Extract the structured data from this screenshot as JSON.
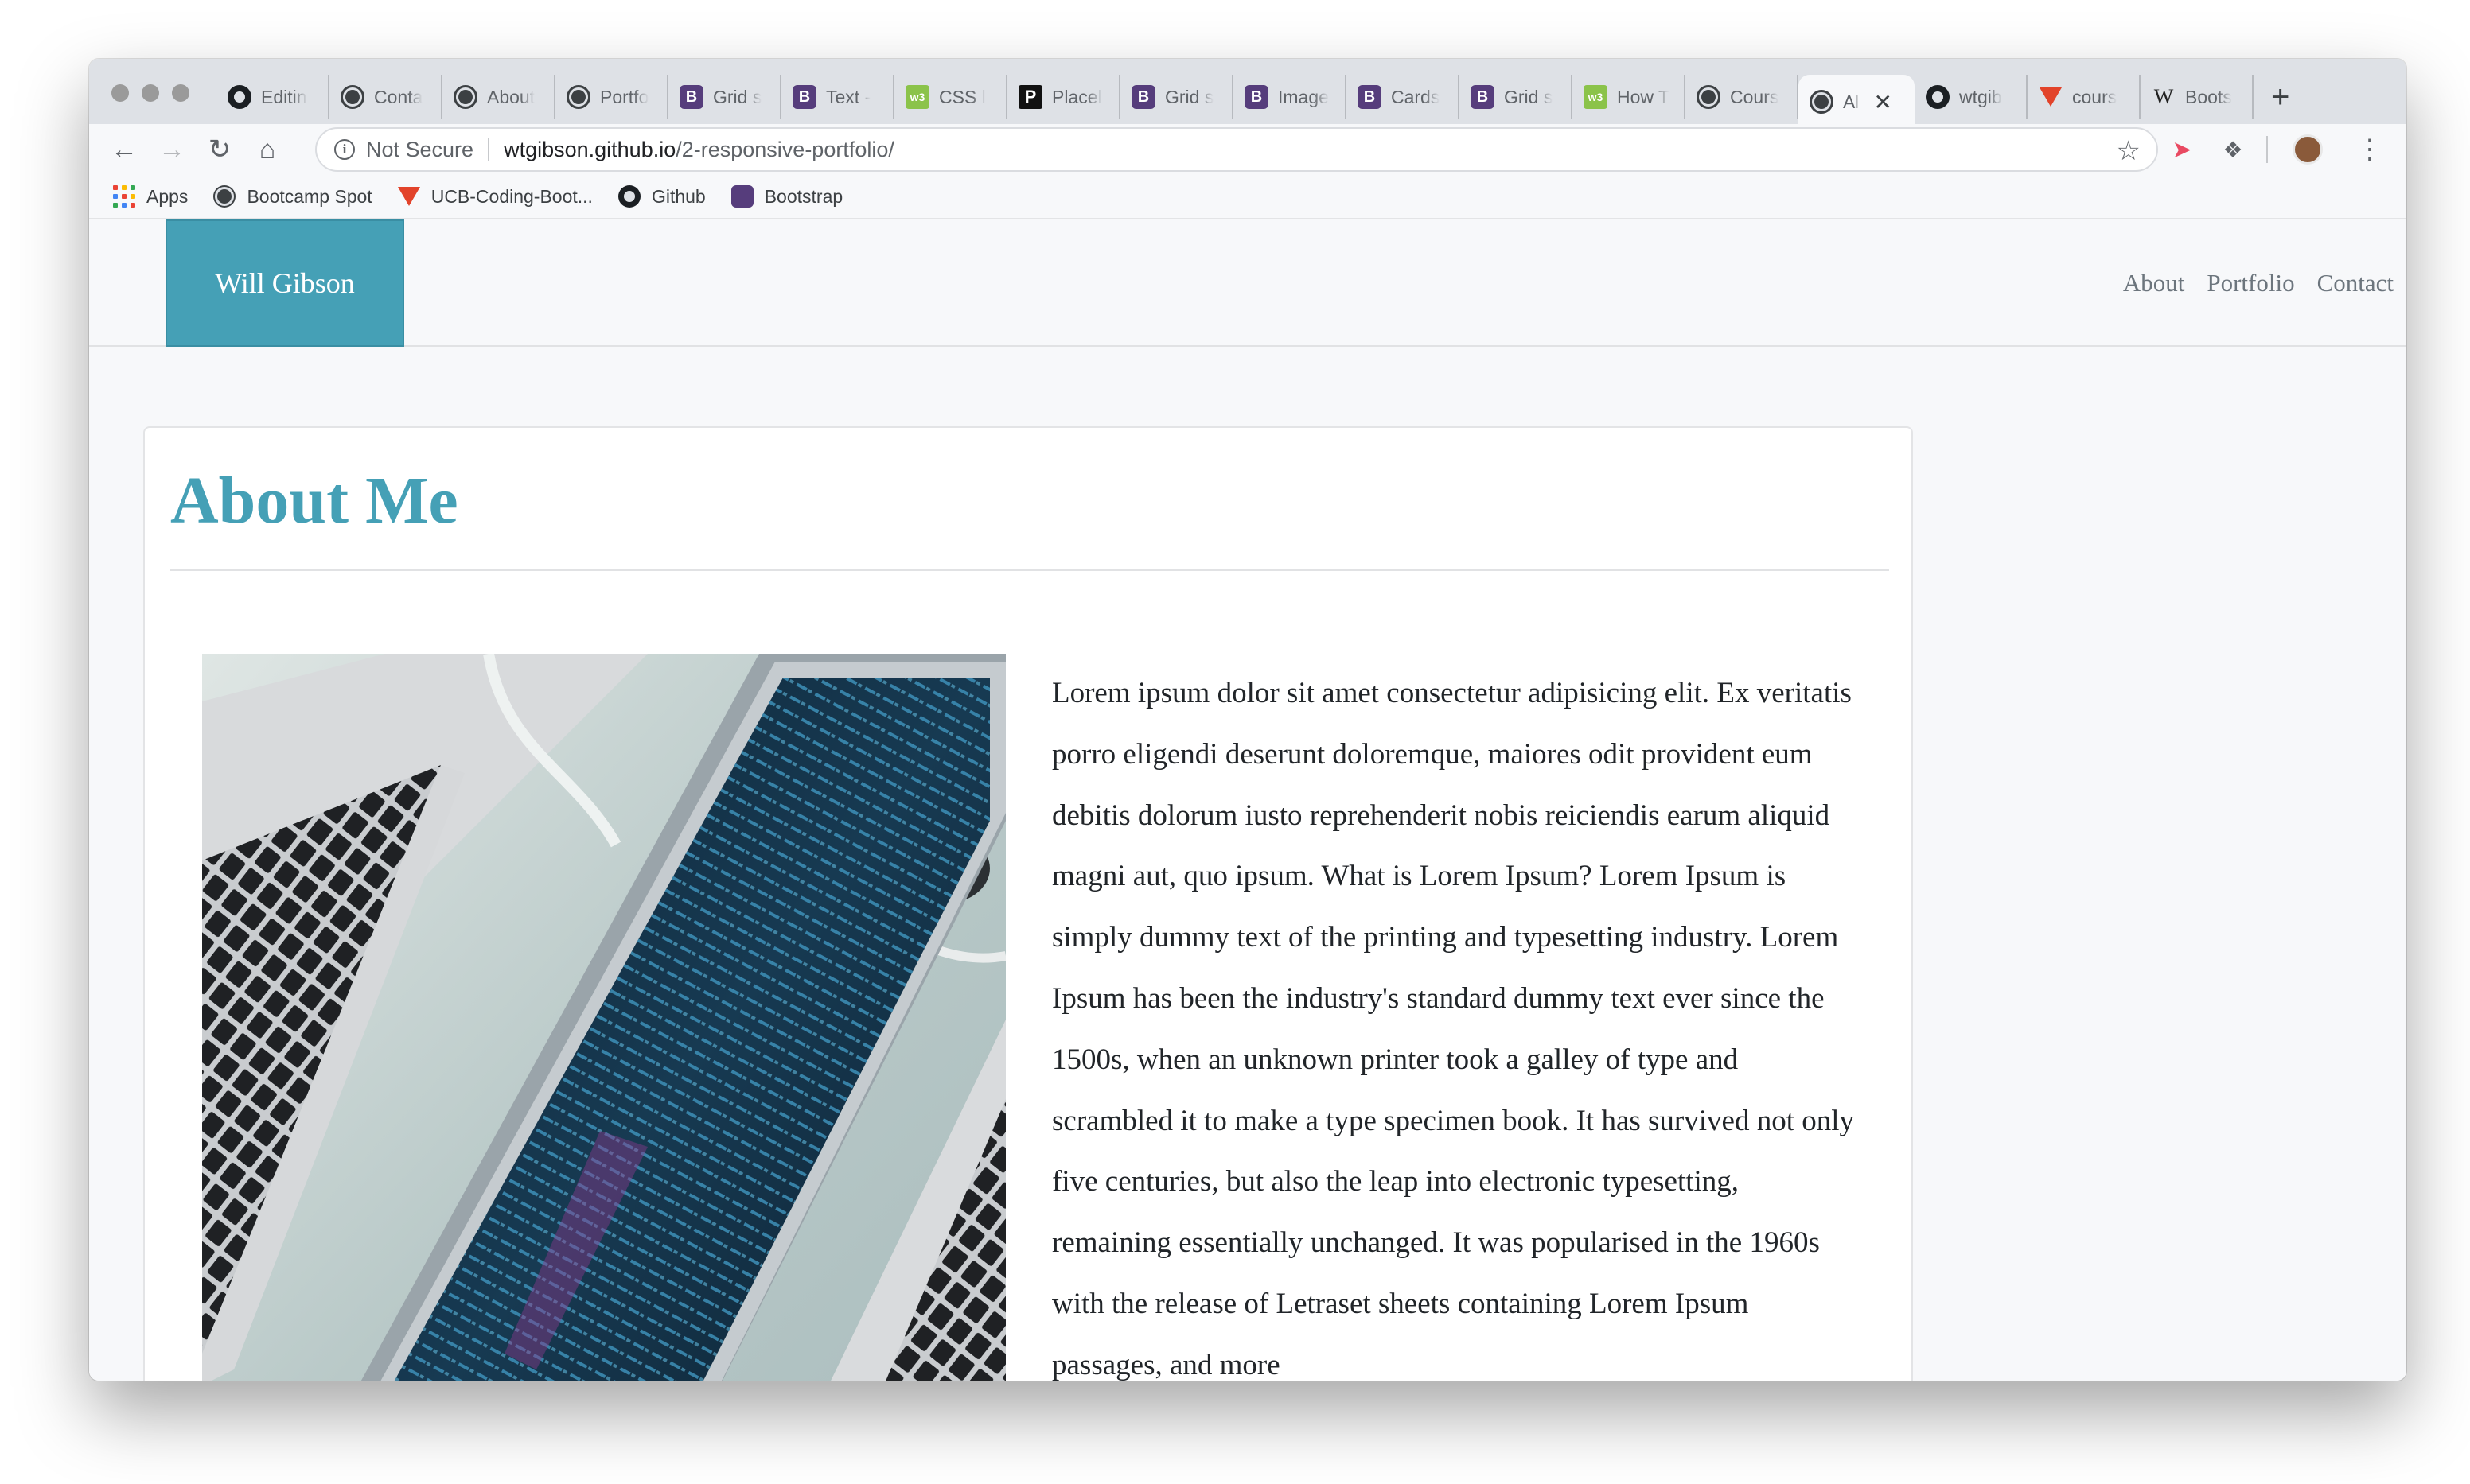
{
  "browser": {
    "tabs": [
      {
        "favicon": "github-icon",
        "label": "Editin"
      },
      {
        "favicon": "globe-icon",
        "label": "Conta"
      },
      {
        "favicon": "globe-icon",
        "label": "About"
      },
      {
        "favicon": "globe-icon",
        "label": "Portfo"
      },
      {
        "favicon": "bootstrap-icon",
        "label": "Grid s"
      },
      {
        "favicon": "bootstrap-icon",
        "label": "Text -"
      },
      {
        "favicon": "w3schools-icon",
        "label": "CSS l"
      },
      {
        "favicon": "placeholder-icon",
        "label": "Placel"
      },
      {
        "favicon": "bootstrap-icon",
        "label": "Grid s"
      },
      {
        "favicon": "bootstrap-icon",
        "label": "Image"
      },
      {
        "favicon": "bootstrap-icon",
        "label": "Cards"
      },
      {
        "favicon": "bootstrap-icon",
        "label": "Grid s"
      },
      {
        "favicon": "w3schools-icon",
        "label": "How T"
      },
      {
        "favicon": "globe-icon",
        "label": "Cours"
      },
      {
        "favicon": "globe-icon",
        "label": "Al",
        "active": true
      },
      {
        "favicon": "github-icon",
        "label": "wtgib"
      },
      {
        "favicon": "gitlab-icon",
        "label": "cours"
      },
      {
        "favicon": "wikipedia-icon",
        "label": "Boots"
      }
    ],
    "new_tab": "+",
    "address_bar": {
      "security_label": "Not Secure",
      "host": "wtgibson.github.io",
      "path": "/2-responsive-portfolio/"
    },
    "bookmarks": [
      {
        "icon": "apps-grid-icon",
        "label": "Apps"
      },
      {
        "icon": "globe-icon",
        "label": "Bootcamp Spot"
      },
      {
        "icon": "gitlab-icon",
        "label": "UCB-Coding-Boot..."
      },
      {
        "icon": "github-icon",
        "label": "Github"
      },
      {
        "icon": "bootstrap-icon",
        "label": "Bootstrap"
      }
    ],
    "colors": {
      "tabstrip": "#dee1e6",
      "toolbar": "#f7f8fa",
      "insecure_ext": "#e94a62"
    }
  },
  "site": {
    "brand": "Will Gibson",
    "nav": [
      "About",
      "Portfolio",
      "Contact"
    ],
    "section_title": "About Me",
    "bio": "Lorem ipsum dolor sit amet consectetur adipisicing elit. Ex veritatis porro eligendi deserunt doloremque, maiores odit provident eum debitis dolorum iusto reprehenderit nobis reiciendis earum aliquid magni aut, quo ipsum. What is Lorem Ipsum? Lorem Ipsum is simply dummy text of the printing and typesetting industry. Lorem Ipsum has been the industry's standard dummy text ever since the 1500s, when an unknown printer took a galley of type and scrambled it to make a type specimen book. It has survived not only five centuries, but also the leap into electronic typesetting, remaining essentially unchanged. It was popularised in the 1960s with the release of Letraset sheets containing Lorem Ipsum passages, and more",
    "photo": "laptop-photo",
    "colors": {
      "accent": "#45a0b6",
      "text": "#212529",
      "nav_text": "#6c757d"
    }
  }
}
